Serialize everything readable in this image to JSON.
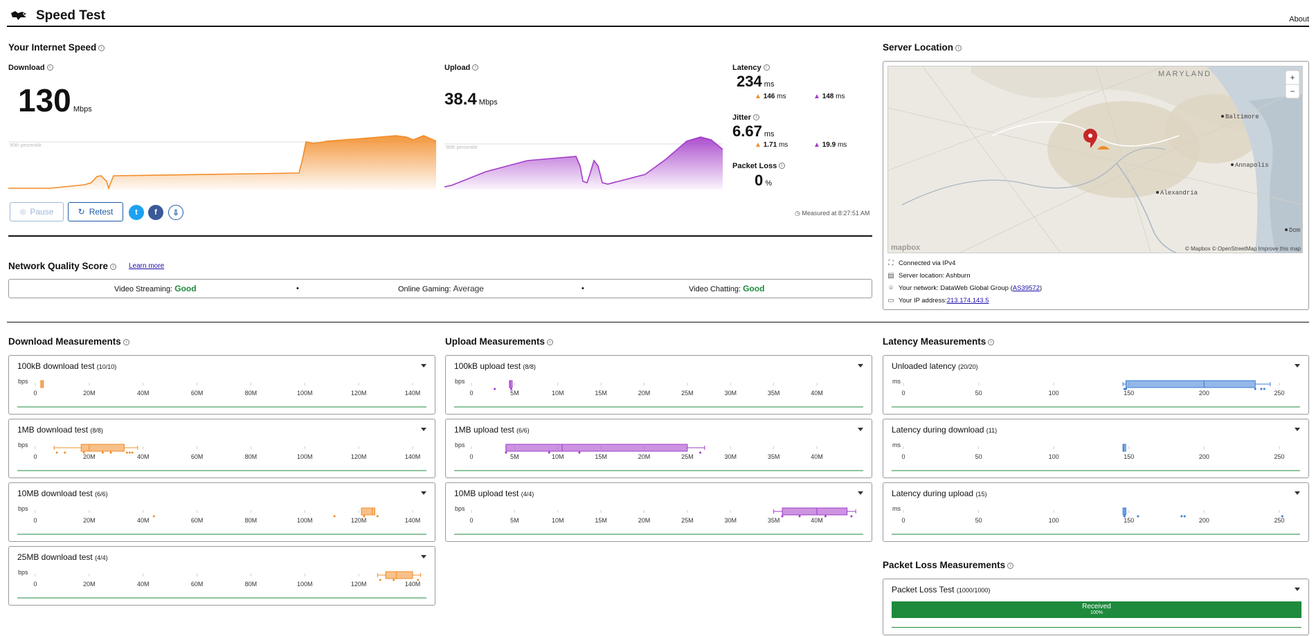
{
  "header": {
    "title": "Speed Test",
    "about": "About"
  },
  "speed": {
    "section_title": "Your Internet Speed",
    "download": {
      "label": "Download",
      "value": "130",
      "unit": "Mbps",
      "percentile": "90th percentile"
    },
    "upload": {
      "label": "Upload",
      "value": "38.4",
      "unit": "Mbps",
      "percentile": "90th percentile"
    },
    "latency": {
      "label": "Latency",
      "value": "234",
      "unit": "ms",
      "down": "146",
      "up": "148",
      "sub_unit": "ms"
    },
    "jitter": {
      "label": "Jitter",
      "value": "6.67",
      "unit": "ms",
      "down": "1.71",
      "up": "19.9",
      "sub_unit": "ms"
    },
    "packet_loss": {
      "label": "Packet Loss",
      "value": "0",
      "unit": "%"
    },
    "pause_label": "Pause",
    "retest_label": "Retest",
    "measured_at": "Measured at 8:27:51 AM"
  },
  "nqs": {
    "title": "Network Quality Score",
    "learn_more": "Learn more",
    "items": [
      {
        "label": "Video Streaming:",
        "value": "Good"
      },
      {
        "label": "Online Gaming:",
        "value": "Average"
      },
      {
        "label": "Video Chatting:",
        "value": "Good"
      }
    ],
    "separator": "•"
  },
  "server": {
    "title": "Server Location",
    "map": {
      "state_label": "MARYLAND",
      "cities": [
        "Baltimore",
        "Annapolis",
        "Alexandria",
        "Dom"
      ],
      "zoom_in": "+",
      "zoom_out": "−",
      "attrib": "© Mapbox © OpenStreetMap  Improve this map",
      "logo": "mapbox"
    },
    "connected": "Connected via IPv4",
    "location": "Server location: Ashburn",
    "network_prefix": "Your network: DataWeb Global Group (",
    "network_link": "AS39572",
    "network_suffix": ")",
    "ip_prefix": "Your IP address: ",
    "ip_link": "213.174.143.5"
  },
  "download_meas": {
    "title": "Download Measurements",
    "axis_unit": "bps",
    "ticks": [
      "0",
      "20M",
      "40M",
      "60M",
      "80M",
      "100M",
      "120M",
      "140M"
    ],
    "cards": [
      {
        "title": "100kB download test",
        "count": "(10/10)"
      },
      {
        "title": "1MB download test",
        "count": "(8/8)"
      },
      {
        "title": "10MB download test",
        "count": "(6/6)"
      },
      {
        "title": "25MB download test",
        "count": "(4/4)"
      }
    ]
  },
  "upload_meas": {
    "title": "Upload Measurements",
    "axis_unit": "bps",
    "ticks": [
      "0",
      "5M",
      "10M",
      "15M",
      "20M",
      "25M",
      "30M",
      "35M",
      "40M"
    ],
    "cards": [
      {
        "title": "100kB upload test",
        "count": "(8/8)"
      },
      {
        "title": "1MB upload test",
        "count": "(6/6)"
      },
      {
        "title": "10MB upload test",
        "count": "(4/4)"
      }
    ]
  },
  "latency_meas": {
    "title": "Latency Measurements",
    "axis_unit": "ms",
    "ticks": [
      "0",
      "50",
      "100",
      "150",
      "200",
      "250"
    ],
    "cards": [
      {
        "title": "Unloaded latency",
        "count": "(20/20)"
      },
      {
        "title": "Latency during download",
        "count": "(11)"
      },
      {
        "title": "Latency during upload",
        "count": "(15)"
      }
    ]
  },
  "packet_meas": {
    "title": "Packet Loss Measurements",
    "card_title": "Packet Loss Test",
    "count": "(1000/1000)",
    "bar_label": "Received",
    "bar_pct": "100%",
    "received_fraction": 1.0
  },
  "colors": {
    "download": "#f28c28",
    "upload": "#a23bc8",
    "latency": "#3a7bd5",
    "good": "#1e8a3c",
    "link": "#1e5aa8"
  }
}
